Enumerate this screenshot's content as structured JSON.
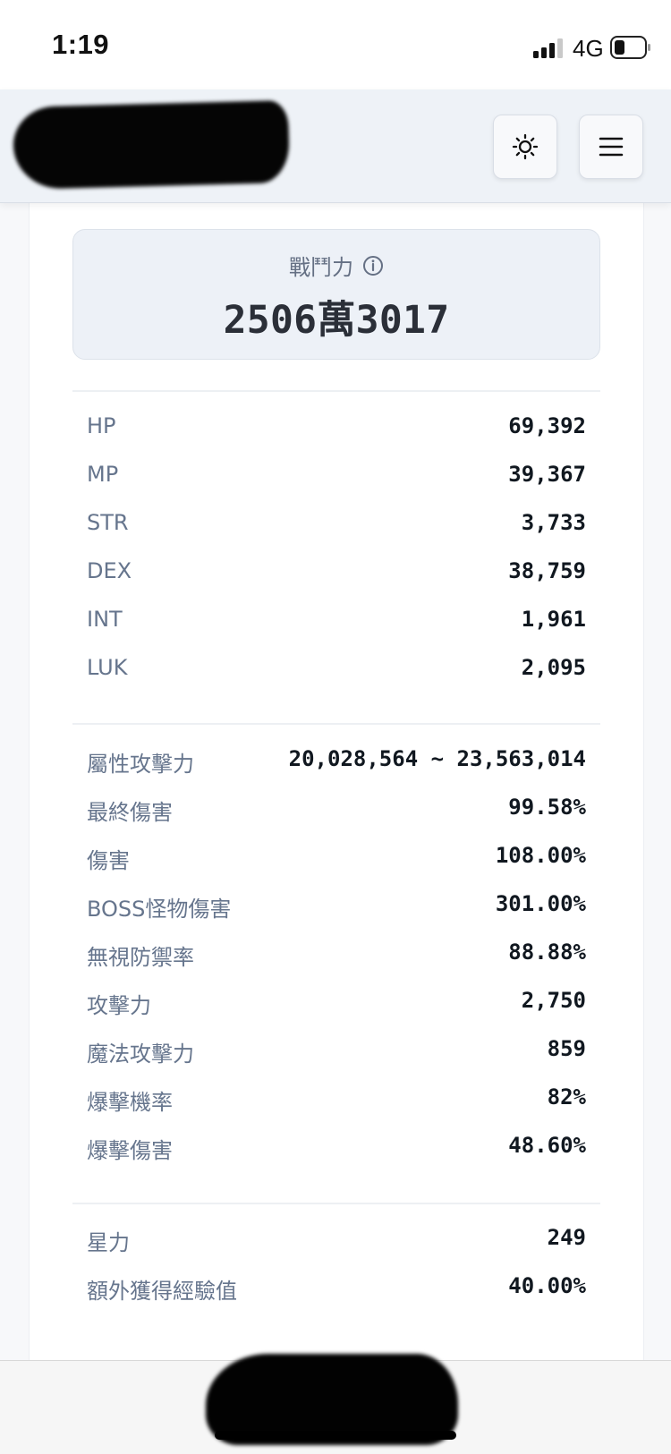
{
  "status_bar": {
    "time": "1:19",
    "network": "4G"
  },
  "header": {
    "theme_button_icon": "sun-icon",
    "menu_button_icon": "hamburger-menu-icon"
  },
  "combat_power": {
    "label": "戰鬥力",
    "info_icon": "info-circle-icon",
    "value": "2506萬3017"
  },
  "base_stats": [
    {
      "label": "HP",
      "value": "69,392"
    },
    {
      "label": "MP",
      "value": "39,367"
    },
    {
      "label": "STR",
      "value": "3,733"
    },
    {
      "label": "DEX",
      "value": "38,759"
    },
    {
      "label": "INT",
      "value": "1,961"
    },
    {
      "label": "LUK",
      "value": "2,095"
    }
  ],
  "attack_stats": [
    {
      "label": "屬性攻擊力",
      "value": "20,028,564 ~ 23,563,014"
    },
    {
      "label": "最終傷害",
      "value": "99.58%"
    },
    {
      "label": "傷害",
      "value": "108.00%"
    },
    {
      "label": "BOSS怪物傷害",
      "value": "301.00%"
    },
    {
      "label": "無視防禦率",
      "value": "88.88%"
    },
    {
      "label": "攻擊力",
      "value": "2,750"
    },
    {
      "label": "魔法攻擊力",
      "value": "859"
    },
    {
      "label": "爆擊機率",
      "value": "82%"
    },
    {
      "label": "爆擊傷害",
      "value": "48.60%"
    }
  ],
  "extra_stats": [
    {
      "label": "星力",
      "value": "249"
    },
    {
      "label": "額外獲得經驗值",
      "value": "40.00%"
    }
  ]
}
